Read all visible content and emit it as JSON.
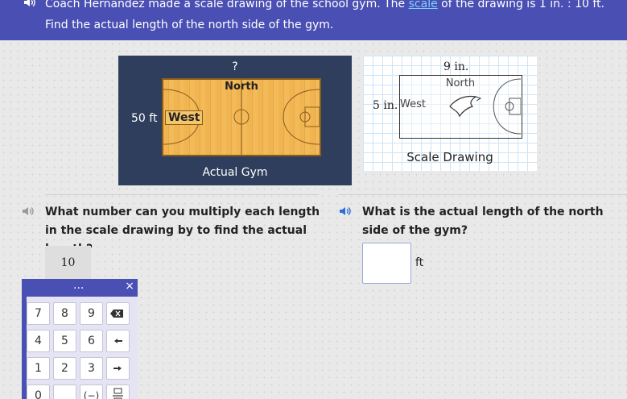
{
  "header": {
    "text_before_link": "Coach Hernández made a scale drawing of the school gym. The",
    "link_text": "scale",
    "text_after_link": "of the drawing is 1 in. : 10 ft.",
    "line2": "Find the actual length of the north side of the gym."
  },
  "actual_gym": {
    "top_label": "?",
    "north_label": "North",
    "west_label": "West",
    "side_length": "50 ft",
    "caption": "Actual Gym"
  },
  "scale_drawing": {
    "top_length": "9 in.",
    "north_label": "North",
    "west_label": "West",
    "side_length": "5 in.",
    "caption": "Scale Drawing"
  },
  "question1": {
    "text": "What number can you multiply each length in the scale drawing by to find the actual length?",
    "answer": "10"
  },
  "question2": {
    "text": "What is the actual length of the north side of the gym?",
    "input_value": "",
    "unit": "ft"
  },
  "keypad": {
    "more_label": "...",
    "close_label": "×",
    "keys": {
      "k7": "7",
      "k8": "8",
      "k9": "9",
      "k4": "4",
      "k5": "5",
      "k6": "6",
      "k1": "1",
      "k2": "2",
      "k3": "3",
      "k0": "0",
      "kneg": "(−)"
    }
  },
  "colors": {
    "header_bg": "#4a4fb3",
    "link": "#7fd0ff",
    "gym_panel_bg": "#2f3e5c",
    "court_wood": "#f0b451"
  }
}
